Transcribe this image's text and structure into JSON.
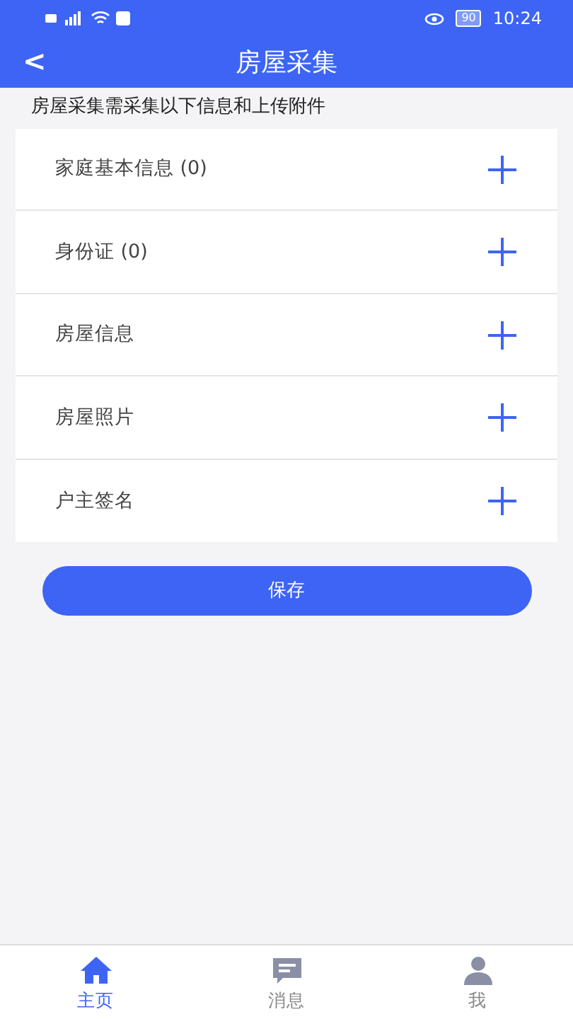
{
  "status_bar": {
    "battery": "90",
    "time": "10:24"
  },
  "header": {
    "back": "<",
    "title": "房屋采集"
  },
  "hint": "房屋采集需采集以下信息和上传附件",
  "items": [
    {
      "label": "家庭基本信息 (0)"
    },
    {
      "label": "身份证 (0)"
    },
    {
      "label": "房屋信息"
    },
    {
      "label": "房屋照片"
    },
    {
      "label": "户主签名"
    }
  ],
  "save_button": "保存",
  "tabs": [
    {
      "label": "主页",
      "kind": "home",
      "selected": true
    },
    {
      "label": "消息",
      "kind": "message",
      "selected": false
    },
    {
      "label": "我",
      "kind": "profile",
      "selected": false
    }
  ]
}
